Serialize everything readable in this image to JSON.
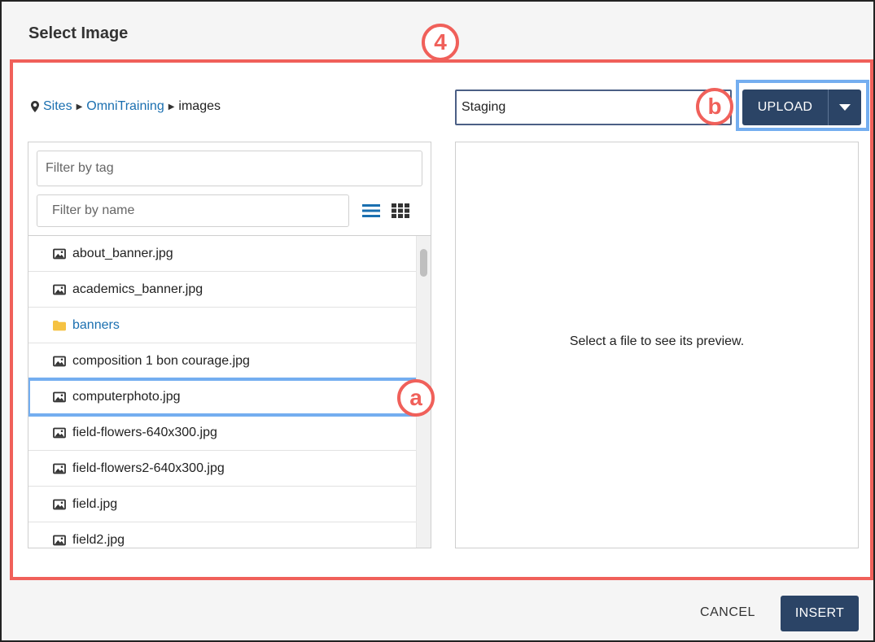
{
  "dialog": {
    "title": "Select Image"
  },
  "callouts": {
    "main": "4",
    "file": "a",
    "upload": "b"
  },
  "breadcrumb": {
    "root": "Sites",
    "site": "OmniTraining",
    "folder": "images"
  },
  "filters": {
    "tag_placeholder": "Filter by tag",
    "name_placeholder": "Filter by name"
  },
  "view_modes": {
    "list_icon": "list-view-icon",
    "grid_icon": "grid-view-icon",
    "active": "list"
  },
  "files": [
    {
      "name": "about_banner.jpg",
      "kind": "image"
    },
    {
      "name": "academics_banner.jpg",
      "kind": "image"
    },
    {
      "name": "banners",
      "kind": "folder"
    },
    {
      "name": "composition 1 bon courage.jpg",
      "kind": "image"
    },
    {
      "name": "computerphoto.jpg",
      "kind": "image",
      "selected": true
    },
    {
      "name": "field-flowers-640x300.jpg",
      "kind": "image"
    },
    {
      "name": "field-flowers2-640x300.jpg",
      "kind": "image"
    },
    {
      "name": "field.jpg",
      "kind": "image"
    },
    {
      "name": "field2.jpg",
      "kind": "image"
    }
  ],
  "source": {
    "value": "Staging"
  },
  "upload": {
    "label": "UPLOAD"
  },
  "preview": {
    "empty_text": "Select a file to see its preview."
  },
  "footer": {
    "cancel_label": "CANCEL",
    "insert_label": "INSERT"
  },
  "colors": {
    "accent": "#2b4466",
    "link": "#1a6fb0",
    "callout": "#f0605a",
    "highlight": "#74aef0",
    "folder": "#f5c242"
  }
}
